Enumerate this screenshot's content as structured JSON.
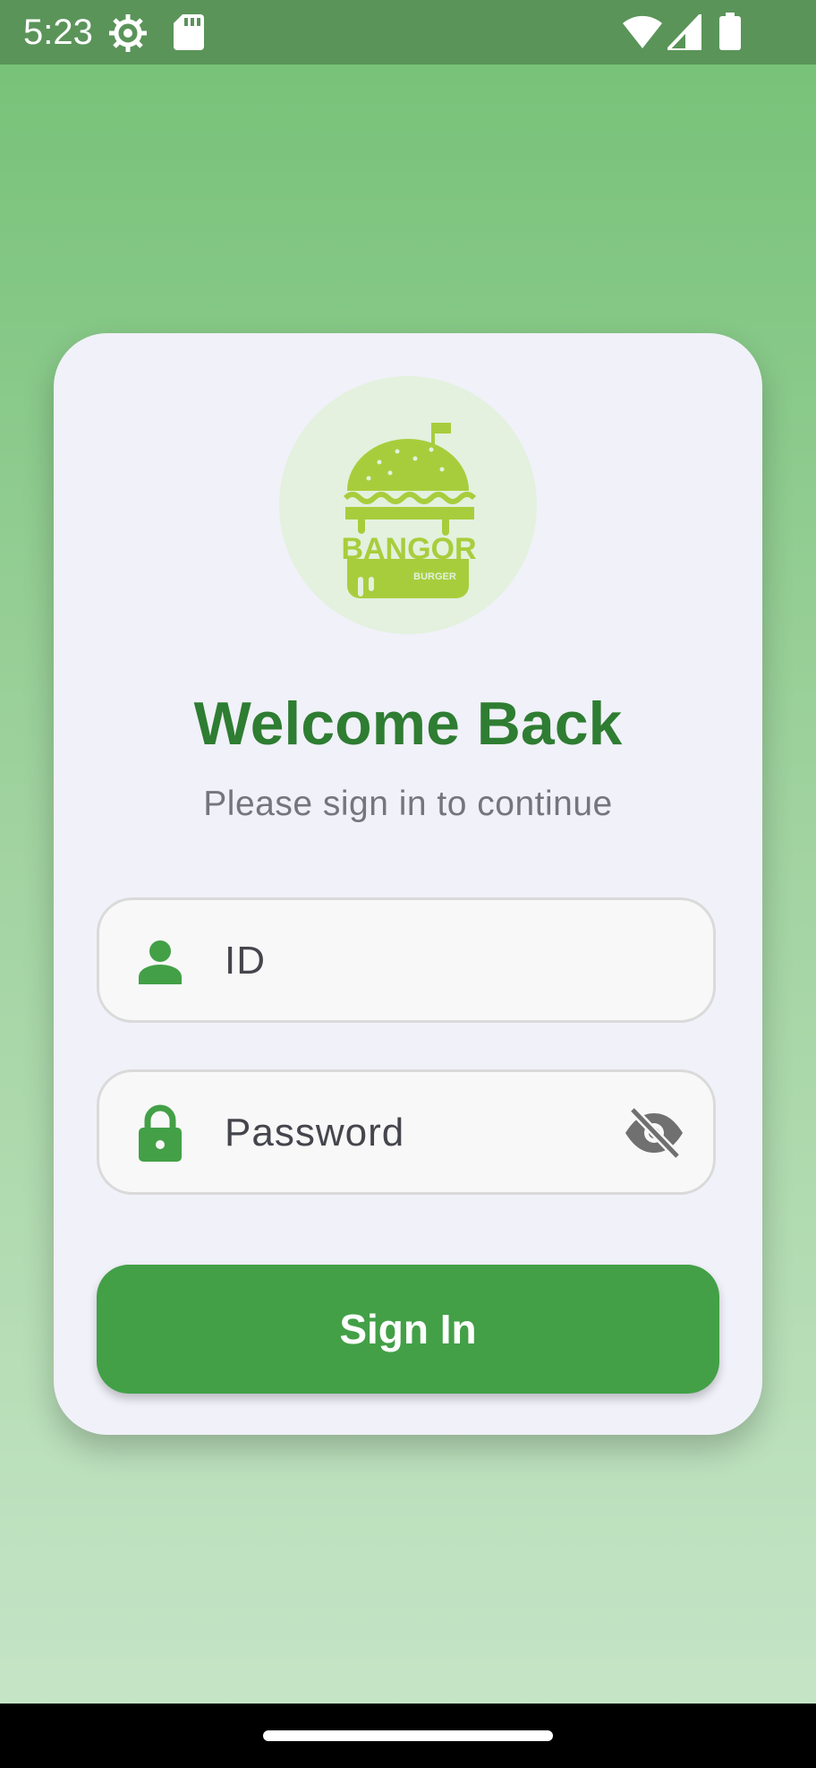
{
  "status_bar": {
    "time": "5:23",
    "icons": [
      "settings-gear-icon",
      "sd-card-icon",
      "wifi-icon",
      "cell-signal-icon",
      "battery-icon"
    ]
  },
  "logo": {
    "brand": "BANGOR",
    "tagline": "BURGER",
    "color": "#a8cd3c",
    "background": "#e3f1de"
  },
  "login": {
    "title": "Welcome Back",
    "subtitle": "Please sign in to continue",
    "id_field": {
      "placeholder": "ID",
      "value": "",
      "icon": "person-icon"
    },
    "password_field": {
      "placeholder": "Password",
      "value": "",
      "icon": "lock-icon",
      "visibility_icon": "visibility-off-icon"
    },
    "submit_label": "Sign In"
  },
  "colors": {
    "primary": "#43a047",
    "title": "#2e7d32",
    "card": "#f1f1f9"
  }
}
